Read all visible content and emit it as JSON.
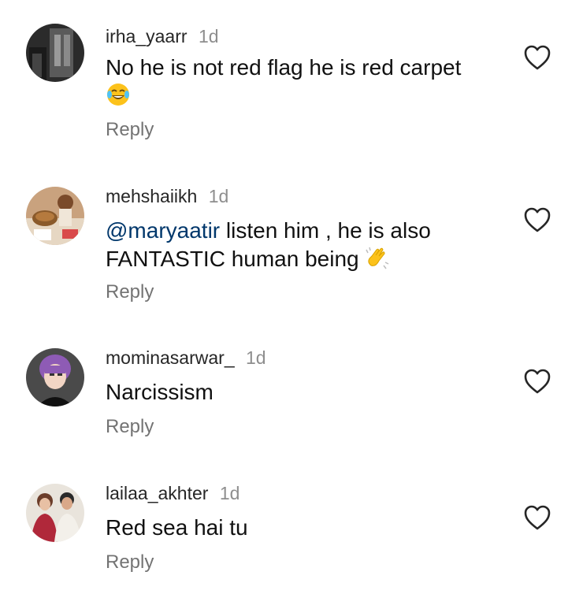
{
  "comments": [
    {
      "username": "irha_yaarr",
      "time": "1d",
      "text": "No he is not red flag he is red carpet",
      "emoji": "face-with-tears-of-joy",
      "reply_label": "Reply",
      "like_icon": "heart-outline-icon"
    },
    {
      "username": "mehshaiikh",
      "time": "1d",
      "mention": "@maryaatir",
      "text_line1": " listen him , he is also",
      "text_line2": "FANTASTIC human being ",
      "emoji": "clapping-hands",
      "reply_label": "Reply",
      "like_icon": "heart-outline-icon"
    },
    {
      "username": "mominasarwar_",
      "time": "1d",
      "text": "Narcissism",
      "reply_label": "Reply",
      "like_icon": "heart-outline-icon"
    },
    {
      "username": "lailaa_akhter",
      "time": "1d",
      "text": "Red sea hai tu",
      "reply_label": "Reply",
      "like_icon": "heart-outline-icon"
    }
  ],
  "colors": {
    "username": "#262626",
    "meta": "#8e8e8e",
    "reply": "#737373",
    "mention": "#00376b",
    "text": "#111111"
  }
}
